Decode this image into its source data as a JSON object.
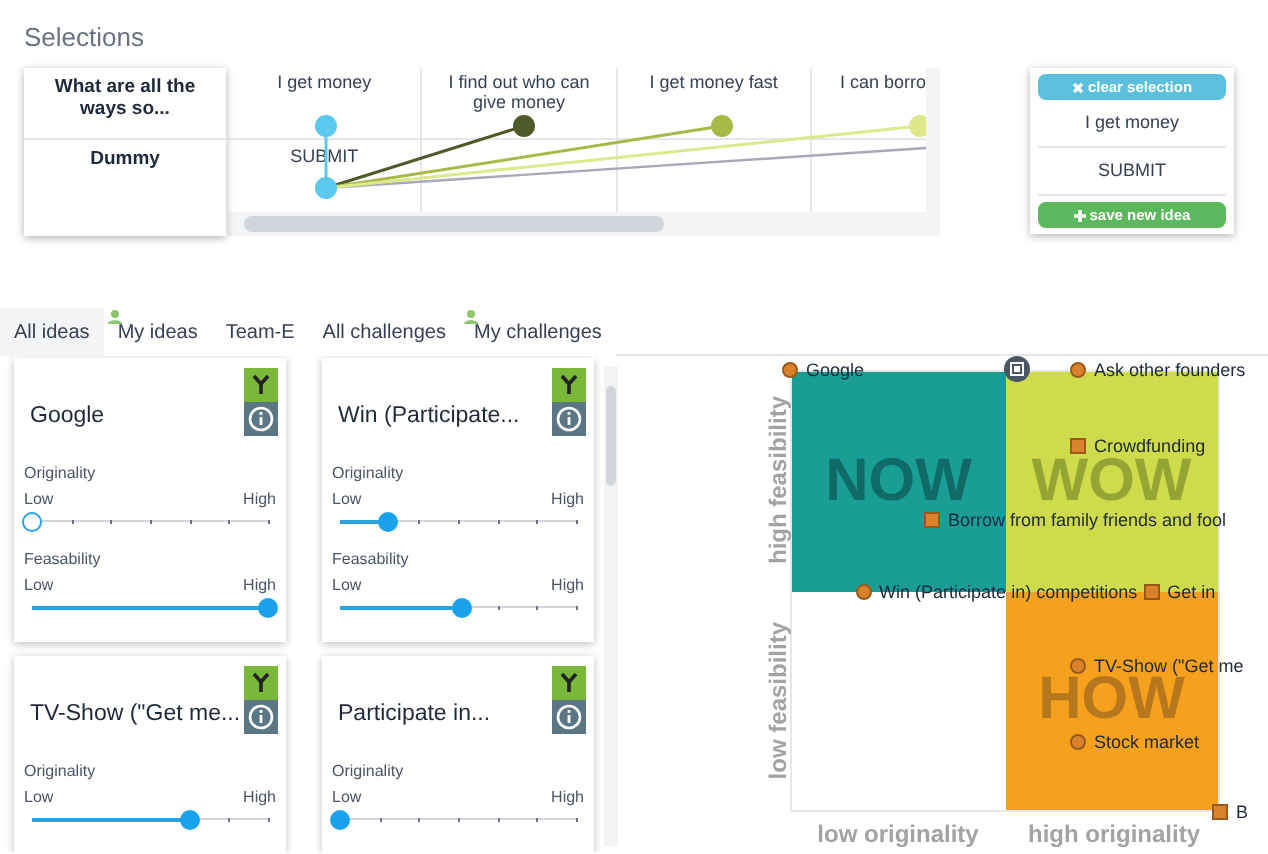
{
  "heading": "Selections",
  "selection_table": {
    "row_headers": [
      "What are all the ways so...",
      "Dummy"
    ],
    "columns": [
      {
        "header": "I get money",
        "cell": "SUBMIT",
        "color": "#5bc8ee"
      },
      {
        "header": "I find out who can give money",
        "color": "#4f5a2a"
      },
      {
        "header": "I get money fast",
        "color": "#a9b948"
      },
      {
        "header": "I can borro",
        "color": "#dfe88a"
      }
    ],
    "extra_link": {
      "color": "#a8a8b8"
    }
  },
  "selection_panel": {
    "clear_button": "clear selection",
    "items": [
      "I get money",
      "SUBMIT"
    ],
    "save_button": "save new idea"
  },
  "tabs": [
    {
      "label": "All ideas",
      "selected": true,
      "personal": false
    },
    {
      "label": "My ideas",
      "selected": false,
      "personal": true
    },
    {
      "label": "Team-E",
      "selected": false,
      "personal": false
    },
    {
      "label": "All challenges",
      "selected": false,
      "personal": false
    },
    {
      "label": "My challenges",
      "selected": false,
      "personal": true
    }
  ],
  "idea_cards": [
    {
      "title": "Google",
      "sliders": [
        {
          "label": "Originality",
          "low": "Low",
          "high": "High",
          "level": 0,
          "rated": false
        },
        {
          "label": "Feasability",
          "low": "Low",
          "high": "High",
          "level": 1,
          "rated": true
        }
      ]
    },
    {
      "title": "Win (Participate...",
      "sliders": [
        {
          "label": "Originality",
          "low": "Low",
          "high": "High",
          "level": 0.2,
          "rated": true
        },
        {
          "label": "Feasability",
          "low": "Low",
          "high": "High",
          "level": 0.52,
          "rated": true
        }
      ]
    },
    {
      "title": "TV-Show (\"Get me...",
      "sliders": [
        {
          "label": "Originality",
          "low": "Low",
          "high": "High",
          "level": 0.67,
          "rated": true
        }
      ]
    },
    {
      "title": "Participate in...",
      "sliders": [
        {
          "label": "Originality",
          "low": "Low",
          "high": "High",
          "level": 0,
          "rated": true
        }
      ]
    }
  ],
  "matrix": {
    "quadrants": [
      {
        "label": "NOW",
        "color": "#1a9e94"
      },
      {
        "label": "WOW",
        "color": "#cedc4c"
      },
      {
        "label": "HOW",
        "color": "#f6a11e"
      }
    ],
    "y_labels": [
      "high feasibility",
      "low feasibility"
    ],
    "x_labels": [
      "low originality",
      "high originality"
    ],
    "points": [
      {
        "label": "Google",
        "kind": "circle"
      },
      {
        "label": "Ask other founders",
        "kind": "circle"
      },
      {
        "label": "Crowdfunding",
        "kind": "square"
      },
      {
        "label": "Borrow from family friends and fool",
        "kind": "square"
      },
      {
        "label": "Win (Participate in) competitions",
        "kind": "circle"
      },
      {
        "label": "Get in",
        "kind": "square"
      },
      {
        "label": "TV-Show (\"Get me",
        "kind": "circle"
      },
      {
        "label": "Stock market",
        "kind": "circle"
      },
      {
        "label": "B",
        "kind": "square"
      }
    ]
  }
}
